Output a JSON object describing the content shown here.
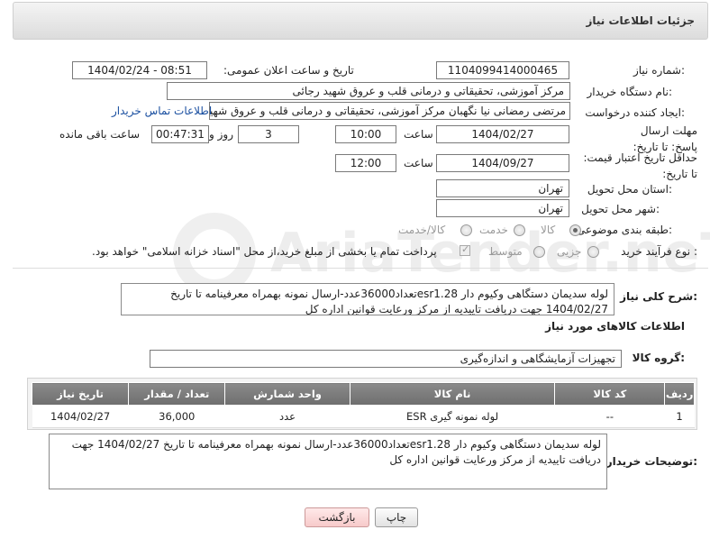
{
  "header": {
    "title": "جزئیات اطلاعات نیاز"
  },
  "watermark": "AriaTender.neT",
  "fields": {
    "need_number_label": "شماره نیاز:",
    "need_number": "1104099414000465",
    "announce_label": "تاریخ و ساعت اعلان عمومی:",
    "announce_value": "1404/02/24 - 08:51",
    "buyer_org_label": "نام دستگاه خریدار:",
    "buyer_org": "مرکز آموزشی، تحقیقاتی و درمانی قلب و عروق شهید رجائی",
    "requester_label": "ایجاد کننده درخواست:",
    "requester": "مرتضی رمضانی نیا نگهبان مرکز آموزشی، تحقیقاتی و درمانی قلب و عروق شهید",
    "contact_link": "اطلاعات تماس خریدار",
    "reply_deadline_label": "مهلت ارسال پاسخ: تا تاریخ:",
    "reply_date": "1404/02/27",
    "time_label": "ساعت",
    "reply_time": "10:00",
    "days_value": "3",
    "days_label": "روز و",
    "remaining_time": "00:47:31",
    "remaining_label": "ساعت باقی مانده",
    "price_validity_label": "حداقل تاریخ اعتبار قیمت: تا تاریخ:",
    "price_date": "1404/09/27",
    "price_time": "12:00",
    "province_label": "استان محل تحویل:",
    "province": "تهران",
    "city_label": "شهر محل تحویل:",
    "city": "تهران",
    "category_label": "طبقه بندی موضوعی:",
    "category_options": [
      "کالا",
      "خدمت",
      "کالا/خدمت"
    ],
    "process_label": "نوع فرآیند خرید :",
    "process_options": [
      "جزیی",
      "متوسط"
    ],
    "payment_note": "پرداخت تمام یا بخشی از مبلغ خرید،از محل \"اسناد خزانه اسلامی\" خواهد بود."
  },
  "summary": {
    "label": "شرح کلی نیاز:",
    "text": "لوله سدیمان دستگاهی وکیوم دار esr1.28تعداد36000عدد-ارسال نمونه بهمراه معرفینامه تا تاریخ 1404/02/27 جهت دریافت تاییدیه از مرکز ورعایت قوانین اداره کل"
  },
  "goods_info_title": "اطلاعات کالاهای مورد نیاز",
  "goods_group": {
    "label": "گروه کالا:",
    "value": "تجهیزات آزمایشگاهی و اندازه‌گیری"
  },
  "table": {
    "headers": [
      "ردیف",
      "کد کالا",
      "نام کالا",
      "واحد شمارش",
      "تعداد / مقدار",
      "تاریخ نیاز"
    ],
    "rows": [
      [
        "1",
        "--",
        "لوله نمونه گیری ESR",
        "عدد",
        "36,000",
        "1404/02/27"
      ]
    ]
  },
  "buyer_notes": {
    "label": "توضیحات خریدار:",
    "text": "لوله سدیمان دستگاهی وکیوم دار esr1.28تعداد36000عدد-ارسال نمونه بهمراه معرفینامه تا تاریخ 1404/02/27 جهت دریافت تاییدیه از مرکز ورعایت قوانین اداره کل"
  },
  "buttons": {
    "print": "چاپ",
    "back": "بازگشت"
  }
}
